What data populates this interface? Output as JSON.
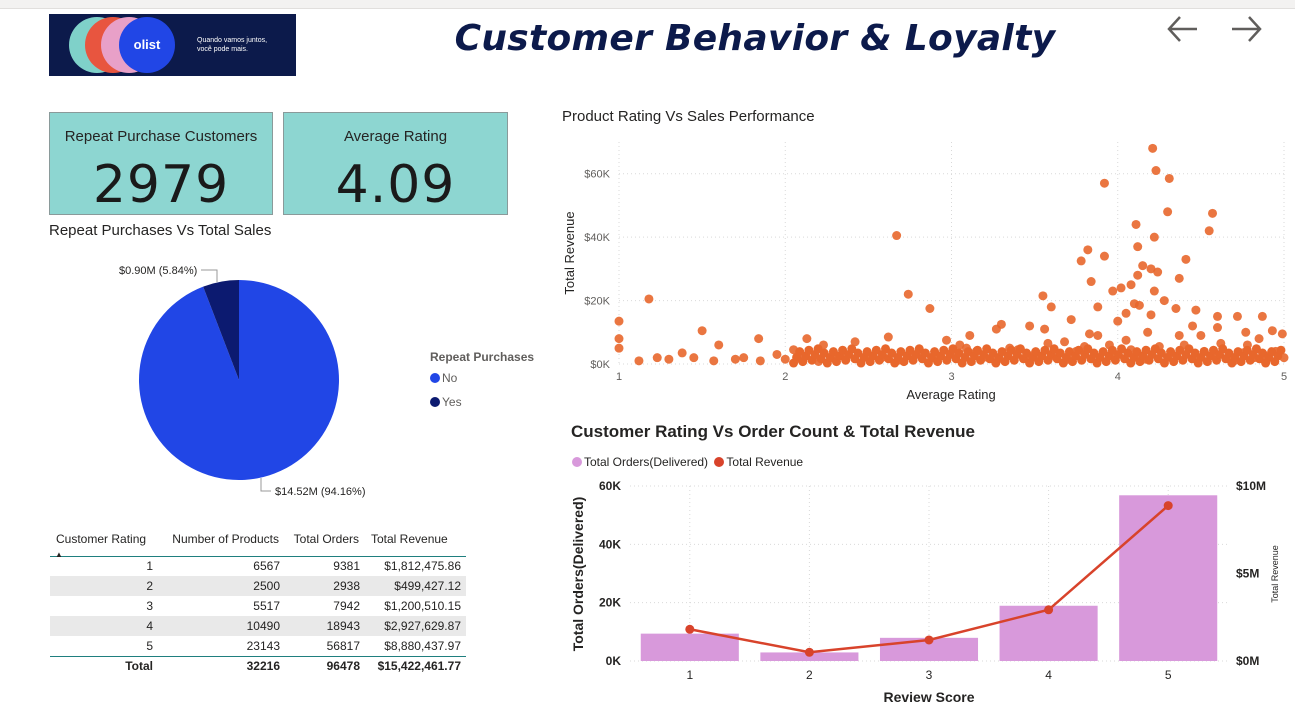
{
  "header": {
    "title": "Customer Behavior & Loyalty",
    "logo_text": "olist",
    "logo_tagline": "Quando vamos juntos, você pode mais."
  },
  "nav": {
    "back_icon": "arrow-left-icon",
    "forward_icon": "arrow-right-icon"
  },
  "kpis": {
    "repeat": {
      "label": "Repeat Purchase Customers",
      "value": "2979"
    },
    "rating": {
      "label": "Average Rating",
      "value": "4.09"
    }
  },
  "pie": {
    "title": "Repeat Purchases Vs Total Sales",
    "legend_title": "Repeat Purchases",
    "slices": [
      {
        "name": "No",
        "value": 14.52,
        "label": "$14.52M (94.16%)",
        "color": "#2146e6"
      },
      {
        "name": "Yes",
        "value": 0.9,
        "label": "$0.90M (5.84%)",
        "color": "#0c1a70"
      }
    ]
  },
  "table": {
    "headers": [
      "Customer Rating",
      "Number of Products",
      "Total Orders",
      "Total Revenue"
    ],
    "rows": [
      [
        "1",
        "6567",
        "9381",
        "$1,812,475.86"
      ],
      [
        "2",
        "2500",
        "2938",
        "$499,427.12"
      ],
      [
        "3",
        "5517",
        "7942",
        "$1,200,510.15"
      ],
      [
        "4",
        "10490",
        "18943",
        "$2,927,629.87"
      ],
      [
        "5",
        "23143",
        "56817",
        "$8,880,437.97"
      ]
    ],
    "total": [
      "Total",
      "32216",
      "96478",
      "$15,422,461.77"
    ]
  },
  "chart_data": [
    {
      "type": "scatter",
      "title": "Product Rating Vs Sales Performance",
      "xlabel": "Average Rating",
      "ylabel": "Total Revenue",
      "xlim": [
        1,
        5
      ],
      "ylim": [
        0,
        70000
      ],
      "x_ticks": [
        "1",
        "2",
        "3",
        "4",
        "5"
      ],
      "y_ticks": [
        "$0K",
        "$20K",
        "$40K",
        "$60K"
      ],
      "color": "#e8672c",
      "grid": true,
      "points": [
        [
          4.21,
          68000
        ],
        [
          4.23,
          61000
        ],
        [
          4.31,
          58500
        ],
        [
          3.92,
          57000
        ],
        [
          4.57,
          47500
        ],
        [
          4.3,
          48000
        ],
        [
          4.11,
          44000
        ],
        [
          4.55,
          42000
        ],
        [
          4.22,
          40000
        ],
        [
          2.67,
          40500
        ],
        [
          4.12,
          37000
        ],
        [
          3.82,
          36000
        ],
        [
          3.92,
          34000
        ],
        [
          4.41,
          33000
        ],
        [
          3.78,
          32500
        ],
        [
          4.2,
          30000
        ],
        [
          4.15,
          31000
        ],
        [
          4.24,
          29000
        ],
        [
          4.12,
          28000
        ],
        [
          4.37,
          27000
        ],
        [
          4.08,
          25000
        ],
        [
          3.84,
          26000
        ],
        [
          4.02,
          24000
        ],
        [
          4.22,
          23000
        ],
        [
          2.74,
          22000
        ],
        [
          3.55,
          21500
        ],
        [
          3.97,
          23000
        ],
        [
          1.18,
          20500
        ],
        [
          4.28,
          20000
        ],
        [
          4.1,
          19000
        ],
        [
          3.88,
          18000
        ],
        [
          4.35,
          17500
        ],
        [
          4.13,
          18500
        ],
        [
          2.87,
          17500
        ],
        [
          3.6,
          18000
        ],
        [
          4.47,
          17000
        ],
        [
          4.05,
          16000
        ],
        [
          4.2,
          15500
        ],
        [
          4.6,
          15000
        ],
        [
          4.87,
          15000
        ],
        [
          4.72,
          15000
        ],
        [
          3.72,
          14000
        ],
        [
          4.0,
          13500
        ],
        [
          3.3,
          12500
        ],
        [
          3.47,
          12000
        ],
        [
          3.27,
          11000
        ],
        [
          4.45,
          12000
        ],
        [
          4.6,
          11500
        ],
        [
          3.56,
          11000
        ],
        [
          4.93,
          10500
        ],
        [
          1.5,
          10500
        ],
        [
          1.0,
          13500
        ],
        [
          4.77,
          10000
        ],
        [
          3.83,
          9500
        ],
        [
          4.18,
          10000
        ],
        [
          4.5,
          9000
        ],
        [
          4.85,
          8000
        ],
        [
          4.99,
          9500
        ],
        [
          3.11,
          9000
        ],
        [
          2.62,
          8500
        ],
        [
          1.84,
          8000
        ],
        [
          3.88,
          9000
        ],
        [
          4.37,
          9000
        ],
        [
          1.0,
          8000
        ],
        [
          2.13,
          8000
        ],
        [
          2.97,
          7500
        ],
        [
          4.05,
          7500
        ],
        [
          3.68,
          7000
        ],
        [
          2.42,
          7000
        ],
        [
          2.23,
          6000
        ],
        [
          1.6,
          6000
        ],
        [
          1.0,
          5000
        ],
        [
          2.05,
          4500
        ],
        [
          4.95,
          4000
        ],
        [
          1.38,
          3500
        ],
        [
          3.09,
          5000
        ],
        [
          4.62,
          6500
        ],
        [
          4.78,
          6000
        ],
        [
          1.23,
          2000
        ],
        [
          1.3,
          1500
        ],
        [
          1.45,
          2000
        ],
        [
          1.57,
          1000
        ],
        [
          1.7,
          1500
        ],
        [
          1.75,
          2000
        ],
        [
          1.85,
          1000
        ],
        [
          2.0,
          1500
        ],
        [
          2.1,
          1200
        ],
        [
          2.2,
          800
        ],
        [
          2.35,
          2500
        ],
        [
          2.5,
          3000
        ],
        [
          2.58,
          2000
        ],
        [
          2.75,
          3500
        ],
        [
          2.82,
          2500
        ],
        [
          2.9,
          1800
        ],
        [
          3.0,
          3500
        ],
        [
          3.05,
          6000
        ],
        [
          3.15,
          4000
        ],
        [
          3.2,
          2200
        ],
        [
          3.35,
          5000
        ],
        [
          3.4,
          4500
        ],
        [
          3.5,
          3000
        ],
        [
          3.58,
          6500
        ],
        [
          3.62,
          2500
        ],
        [
          3.75,
          4000
        ],
        [
          3.8,
          5500
        ],
        [
          3.86,
          3000
        ],
        [
          3.95,
          6000
        ],
        [
          4.08,
          4500
        ],
        [
          4.14,
          2500
        ],
        [
          4.25,
          5500
        ],
        [
          4.32,
          3500
        ],
        [
          4.4,
          6000
        ],
        [
          4.52,
          4000
        ],
        [
          4.58,
          2500
        ],
        [
          4.67,
          3000
        ],
        [
          4.75,
          3500
        ],
        [
          4.82,
          2000
        ],
        [
          4.9,
          2500
        ],
        [
          5.0,
          2000
        ],
        [
          1.12,
          1000
        ],
        [
          1.95,
          3000
        ],
        [
          2.3,
          1500
        ],
        [
          2.68,
          1200
        ],
        [
          3.28,
          1500
        ],
        [
          3.45,
          2000
        ],
        [
          3.7,
          1500
        ],
        [
          3.98,
          2000
        ],
        [
          4.17,
          1500
        ],
        [
          4.47,
          2000
        ],
        [
          4.7,
          1000
        ]
      ]
    },
    {
      "type": "bar",
      "title": "Customer Rating Vs Order Count & Total Revenue",
      "xlabel": "Review Score",
      "ylabel": "Total Orders(Delivered)",
      "y2label": "Total Revenue",
      "categories": [
        "1",
        "2",
        "3",
        "4",
        "5"
      ],
      "ylim": [
        0,
        60000
      ],
      "y2lim": [
        0,
        10000000
      ],
      "y_ticks": [
        "0K",
        "20K",
        "40K",
        "60K"
      ],
      "y2_ticks": [
        "$0M",
        "$5M",
        "$10M"
      ],
      "series": [
        {
          "name": "Total Orders(Delivered)",
          "type": "bar",
          "color": "#d899db",
          "values": [
            9381,
            2938,
            7942,
            18943,
            56817
          ]
        },
        {
          "name": "Total Revenue",
          "type": "line",
          "color": "#d8432b",
          "values": [
            1812475.86,
            499427.12,
            1200510.15,
            2927629.87,
            8880437.97
          ]
        }
      ],
      "legend": "top-left",
      "grid": true
    }
  ]
}
